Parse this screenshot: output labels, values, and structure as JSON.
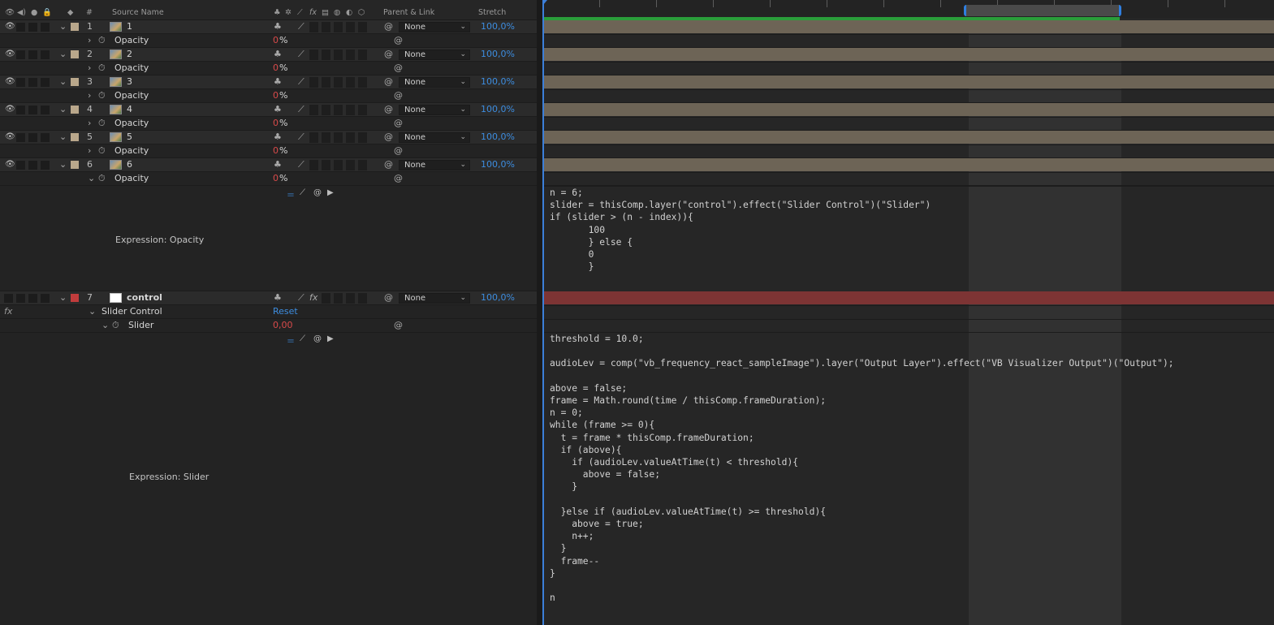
{
  "header": {
    "caption": "",
    "hash": "#",
    "source_name": "Source Name",
    "parent_link": "Parent & Link",
    "stretch": "Stretch",
    "fx": "fx"
  },
  "layers": [
    {
      "index": "1",
      "name": "1",
      "property": "Opacity",
      "value": "0",
      "unit": "%",
      "parent": "None",
      "stretch": "100,0%"
    },
    {
      "index": "2",
      "name": "2",
      "property": "Opacity",
      "value": "0",
      "unit": "%",
      "parent": "None",
      "stretch": "100,0%"
    },
    {
      "index": "3",
      "name": "3",
      "property": "Opacity",
      "value": "0",
      "unit": "%",
      "parent": "None",
      "stretch": "100,0%"
    },
    {
      "index": "4",
      "name": "4",
      "property": "Opacity",
      "value": "0",
      "unit": "%",
      "parent": "None",
      "stretch": "100,0%"
    },
    {
      "index": "5",
      "name": "5",
      "property": "Opacity",
      "value": "0",
      "unit": "%",
      "parent": "None",
      "stretch": "100,0%"
    },
    {
      "index": "6",
      "name": "6",
      "property": "Opacity",
      "value": "0",
      "unit": "%",
      "parent": "None",
      "stretch": "100,0%"
    }
  ],
  "expression_opacity": {
    "label": "Expression: Opacity",
    "code": "n = 6;\nslider = thisComp.layer(\"control\").effect(\"Slider Control\")(\"Slider\")\nif (slider > (n - index)){\n       100\n       } else {\n       0\n       }"
  },
  "control_layer": {
    "index": "7",
    "name": "control",
    "parent": "None",
    "stretch": "100,0%",
    "fx_label": "fx",
    "effect_name": "Slider Control",
    "reset": "Reset",
    "property": "Slider",
    "value": "0,00"
  },
  "expression_slider": {
    "label": "Expression: Slider",
    "code": "threshold = 10.0;\n\naudioLev = comp(\"vb_frequency_react_sampleImage\").layer(\"Output Layer\").effect(\"VB Visualizer Output\")(\"Output\");\n\nabove = false;\nframe = Math.round(time / thisComp.frameDuration);\nn = 0;\nwhile (frame >= 0){\n  t = frame * thisComp.frameDuration;\n  if (above){\n    if (audioLev.valueAtTime(t) < threshold){\n      above = false;\n    }\n\n  }else if (audioLev.valueAtTime(t) >= threshold){\n    above = true;\n    n++;\n  }\n  frame--\n}\n\nn"
  },
  "colors": {
    "label_tan": "#b9a78b",
    "label_red": "#c13c3c",
    "track_tan": "#6d6456",
    "track_red": "#7d3434",
    "accent_blue": "#3d8de0",
    "value_red": "#d84a4a",
    "work_area_green": "#2a9d3a"
  }
}
